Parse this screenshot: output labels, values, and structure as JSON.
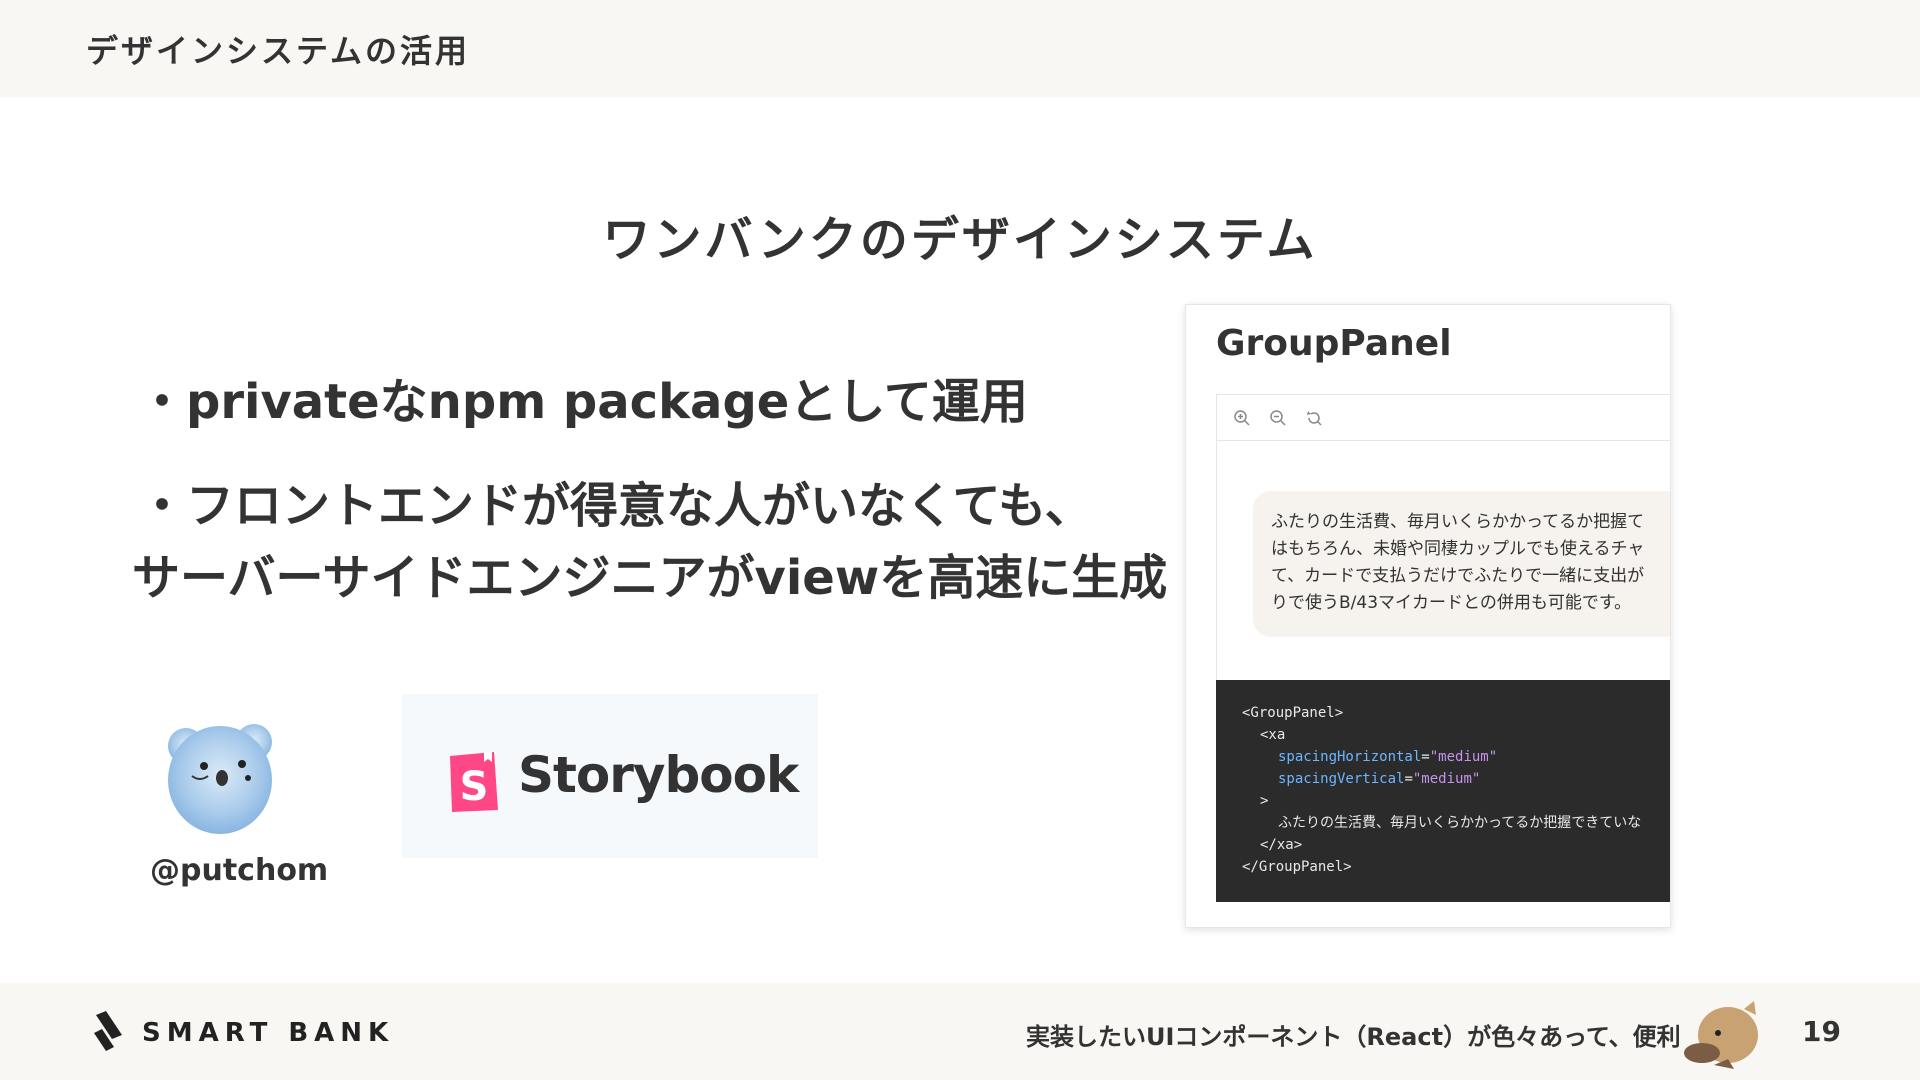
{
  "header": {
    "title": "デザインシステムの活用"
  },
  "slide": {
    "heading": "ワンバンクのデザインシステム",
    "bullets": [
      "・privateなnpm packageとして運用",
      "・フロントエンドが得意な人がいなくても、",
      "サーバーサイドエンジニアがviewを高速に生成"
    ]
  },
  "profile": {
    "handle": "@putchom",
    "avatar_icon": "koala-avatar-icon"
  },
  "storybook": {
    "logo_icon": "storybook-logo-icon",
    "name": "Storybook",
    "brand_color": "#ff4785"
  },
  "panel": {
    "title": "GroupPanel",
    "toolbar_icons": [
      "zoom-in-icon",
      "zoom-out-icon",
      "reset-zoom-icon"
    ],
    "bubble_lines": [
      "ふたりの生活費、毎月いくらかかってるか把握て",
      "はもちろん、未婚や同棲カップルでも使えるチャ",
      "て、カードで支払うだけでふたりで一緒に支出が",
      "りで使うB/43マイカードとの併用も可能です。"
    ],
    "code": {
      "line1": "<GroupPanel>",
      "line2": "<xa",
      "line3_attr": "spacingHorizontal",
      "line3_val": "\"medium\"",
      "line4_attr": "spacingVertical",
      "line4_val": "\"medium\"",
      "line5": ">",
      "line6": "ふたりの生活費、毎月いくらかかってるか把握できていな",
      "line7": "</xa>",
      "line8": "</GroupPanel>"
    }
  },
  "footer": {
    "brand": "SMART BANK",
    "brand_icon": "smartbank-logo-icon",
    "caption": "実装したいUIコンポーネント（React）が色々あって、便利",
    "mascot_icon": "platypus-mascot-icon",
    "page_number": "19"
  },
  "colors": {
    "header_bg": "#f8f7f3",
    "text": "#333333",
    "code_bg": "#2b2b2b",
    "storybook_pink": "#ff4785"
  }
}
